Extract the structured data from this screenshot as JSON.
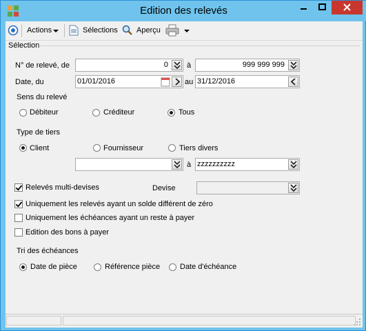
{
  "window": {
    "title": "Edition des relevés",
    "close_color": "#c7372e",
    "frame_color": "#6fc3ec"
  },
  "toolbar": {
    "actions_label": "Actions",
    "selections_label": "Sélections",
    "apercu_label": "Aperçu",
    "icons": [
      "radio-target-icon",
      "document-icon",
      "magnifier-icon",
      "printer-icon",
      "chevron-down-icon"
    ]
  },
  "selection": {
    "group_label": "Sélection",
    "releve_label": "N° de relevé, de",
    "releve_from": "0",
    "a_label_1": "à",
    "releve_to": "999 999 999",
    "date_label": "Date, du",
    "date_from": "01/01/2016",
    "au_label": "au",
    "date_to": "31/12/2016"
  },
  "sens": {
    "label": "Sens du relevé",
    "options": [
      "Débiteur",
      "Créditeur",
      "Tous"
    ],
    "selected": "Tous"
  },
  "tiers": {
    "label": "Type de tiers",
    "options": [
      "Client",
      "Fournisseur",
      "Tiers divers"
    ],
    "selected": "Client",
    "from_value": "",
    "a_label": "à",
    "to_value": "zzzzzzzzzz"
  },
  "options": {
    "multi_devises": {
      "label": "Relevés multi-devises",
      "checked": true
    },
    "devise_label": "Devise",
    "devise_value": "",
    "solde": {
      "label": "Uniquement les relevés ayant un solde différent de zéro",
      "checked": true
    },
    "reste": {
      "label": "Uniquement les échéances ayant un reste à payer",
      "checked": false
    },
    "bons": {
      "label": "Edition des bons à payer",
      "checked": false
    }
  },
  "tri": {
    "label": "Tri des échéances",
    "options": [
      "Date de pièce",
      "Référence pièce",
      "Date d'échéance"
    ],
    "selected": "Date de pièce"
  }
}
